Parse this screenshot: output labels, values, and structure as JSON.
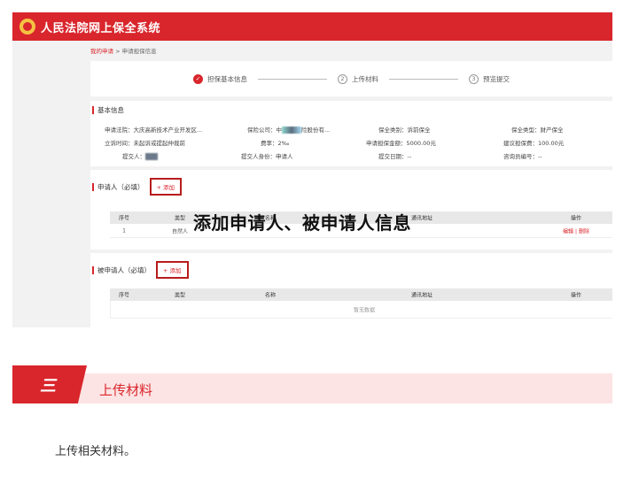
{
  "header": {
    "title": "人民法院网上保全系统"
  },
  "breadcrumb": {
    "link": "我的申请",
    "separator": " > ",
    "current": "申请担保信息"
  },
  "steps": [
    {
      "num": "1",
      "label": "担保基本信息",
      "state": "done"
    },
    {
      "num": "2",
      "label": "上传材料",
      "state": "pending"
    },
    {
      "num": "3",
      "label": "预览提交",
      "state": "pending"
    }
  ],
  "basic": {
    "title": "基本信息",
    "court_label": "申请法院：",
    "court_value": "大庆高新技术产业开发区...",
    "insurer_label": "保险公司：",
    "insurer_prefix": "中",
    "insurer_suffix": "险股份有...",
    "type_label": "保全类别：",
    "type_value": "诉前保全",
    "kind_label": "保全类型：",
    "kind_value": "财产保全",
    "time_label": "立诉时间：",
    "time_value": "未起诉或提起仲裁前",
    "rate_label": "费率：",
    "rate_value": "2‰",
    "amount_label": "申请担保金额：",
    "amount_value": "5000.00元",
    "fee_label": "建议担保费：",
    "fee_value": "100.00元",
    "submitter_label": "提交人：",
    "identity_label": "提交人身份：",
    "identity_value": "申请人",
    "date_label": "提交日期：",
    "date_value": "--",
    "consult_label": "咨询员编号：",
    "consult_value": "--"
  },
  "applicant": {
    "title": "申请人（必填）",
    "add_label": "+ 添加",
    "columns": [
      "序号",
      "类型",
      "名称",
      "通讯地址",
      "操作"
    ],
    "rows": [
      {
        "no": "1",
        "type": "自然人",
        "edit": "编辑",
        "sep": "|",
        "del": "删除"
      }
    ]
  },
  "respondent": {
    "title": "被申请人（必填）",
    "add_label": "+ 添加",
    "columns": [
      "序号",
      "类型",
      "名称",
      "通讯地址",
      "操作"
    ],
    "empty_text": "暂无数据"
  },
  "overlay_caption": "添加申请人、被申请人信息",
  "section": {
    "icon": "三",
    "title": "上传材料"
  },
  "description": "上传相关材料。",
  "colors": {
    "brand_red": "#d9262c",
    "section_bg": "#fde4e4"
  }
}
